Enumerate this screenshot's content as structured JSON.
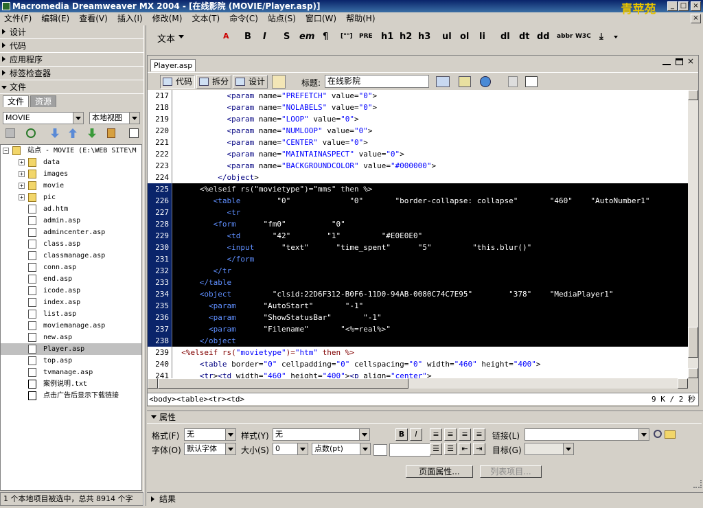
{
  "window": {
    "title": "Macromedia Dreamweaver MX 2004 - [在线影院 (MOVIE/Player.asp)]",
    "watermark": "青苹苑",
    "controls": [
      "_",
      "□",
      "×"
    ]
  },
  "menu": [
    "文件(F)",
    "编辑(E)",
    "查看(V)",
    "插入(I)",
    "修改(M)",
    "文本(T)",
    "命令(C)",
    "站点(S)",
    "窗口(W)",
    "帮助(H)"
  ],
  "left_panels": [
    {
      "label": "设计",
      "open": false
    },
    {
      "label": "代码",
      "open": false
    },
    {
      "label": "应用程序",
      "open": false
    },
    {
      "label": "标签检查器",
      "open": false
    },
    {
      "label": "文件",
      "open": true
    }
  ],
  "files": {
    "tabs": [
      "文件",
      "资源"
    ],
    "site_select": "MOVIE",
    "view_select": "本地视图",
    "root": "站点 - MOVIE (E:\\WEB SITE\\M",
    "items": [
      {
        "name": "data",
        "type": "folder"
      },
      {
        "name": "images",
        "type": "folder"
      },
      {
        "name": "movie",
        "type": "folder"
      },
      {
        "name": "pic",
        "type": "folder"
      },
      {
        "name": "ad.htm",
        "type": "doc"
      },
      {
        "name": "admin.asp",
        "type": "doc"
      },
      {
        "name": "admincenter.asp",
        "type": "doc"
      },
      {
        "name": "class.asp",
        "type": "doc"
      },
      {
        "name": "classmanage.asp",
        "type": "doc"
      },
      {
        "name": "conn.asp",
        "type": "doc"
      },
      {
        "name": "end.asp",
        "type": "doc"
      },
      {
        "name": "icode.asp",
        "type": "doc"
      },
      {
        "name": "index.asp",
        "type": "doc"
      },
      {
        "name": "list.asp",
        "type": "doc"
      },
      {
        "name": "moviemanage.asp",
        "type": "doc"
      },
      {
        "name": "new.asp",
        "type": "doc"
      },
      {
        "name": "Player.asp",
        "type": "doc",
        "selected": true
      },
      {
        "name": "top.asp",
        "type": "doc"
      },
      {
        "name": "tvmanage.asp",
        "type": "doc"
      },
      {
        "name": "案例说明.txt",
        "type": "txt"
      },
      {
        "name": "点击广告后显示下载链接",
        "type": "txt"
      }
    ],
    "status": "1 个本地项目被选中，总共 8914 个字"
  },
  "insert_bar": {
    "category": "文本",
    "items": [
      "B",
      "I",
      "S",
      "em",
      "¶",
      "[\"\"]",
      "PRE",
      "h1",
      "h2",
      "h3",
      "ul",
      "ol",
      "li",
      "dl",
      "dt",
      "dd",
      "abbr",
      "W3C"
    ]
  },
  "document": {
    "tab": "Player.asp",
    "toolbar": {
      "code": "代码",
      "split": "拆分",
      "design": "设计",
      "title_label": "标题:",
      "title_value": "在线影院"
    },
    "lines": [
      {
        "n": "217",
        "text": "            <param name=\"PREFETCH\" value=\"0\">",
        "hl": false
      },
      {
        "n": "218",
        "text": "            <param name=\"NOLABELS\" value=\"0\">",
        "hl": false
      },
      {
        "n": "219",
        "text": "            <param name=\"LOOP\" value=\"0\">",
        "hl": false
      },
      {
        "n": "220",
        "text": "            <param name=\"NUMLOOP\" value=\"0\">",
        "hl": false
      },
      {
        "n": "221",
        "text": "            <param name=\"CENTER\" value=\"0\">",
        "hl": false
      },
      {
        "n": "222",
        "text": "            <param name=\"MAINTAINASPECT\" value=\"0\">",
        "hl": false
      },
      {
        "n": "223",
        "text": "            <param name=\"BACKGROUNDCOLOR\" value=\"#000000\">",
        "hl": false
      },
      {
        "n": "224",
        "text": "          </object>",
        "hl": false
      },
      {
        "n": "225",
        "text": "      <%elseif rs(\"movietype\")=\"mms\" then %>",
        "hl": true
      },
      {
        "n": "226",
        "text": "         <table border=\"0\" cellspacing=\"0\" style=\"border-collapse: collapse\" width=\"460\" id=\"AutoNumber1\"",
        "hl": true
      },
      {
        "n": "227",
        "text": "            <tr>",
        "hl": true
      },
      {
        "n": "228",
        "text": "         <form name=\"fm0\" onsubmit=\"0\">",
        "hl": true
      },
      {
        "n": "229",
        "text": "            <td width=\"42\" height=\"1\" bgcolor=\"#E0E0E0\">",
        "hl": true
      },
      {
        "n": "230",
        "text": "            <input type=\"text\" name=\"time_spent\" size=\"5\" onFocus=\"this.blur()\" style=\"border-style: groove",
        "hl": true
      },
      {
        "n": "231",
        "text": "            </form>",
        "hl": true
      },
      {
        "n": "232",
        "text": "         </tr>",
        "hl": true
      },
      {
        "n": "233",
        "text": "      </table>",
        "hl": true
      },
      {
        "n": "234",
        "text": "      <object classid=\"clsid:22D6F312-B0F6-11D0-94AB-0080C74C7E95\" height=\"378\" id=\"MediaPlayer1\" width=\"46",
        "hl": true
      },
      {
        "n": "235",
        "text": "        <param name=\"AutoStart\" value=\"-1\">",
        "hl": true
      },
      {
        "n": "236",
        "text": "        <param name=\"ShowStatusBar\" value=\"-1\">",
        "hl": true
      },
      {
        "n": "237",
        "text": "        <param name=\"Filename\" value=\"<%=real%>\">",
        "hl": true
      },
      {
        "n": "238",
        "text": "      </object>",
        "hl": true
      },
      {
        "n": "239",
        "text": "  <%elseif rs(\"movietype\")=\"htm\" then %>",
        "hl": false
      },
      {
        "n": "240",
        "text": "      <table border=\"0\" cellpadding=\"0\" cellspacing=\"0\" width=\"460\" height=\"400\">",
        "hl": false
      },
      {
        "n": "241",
        "text": "      <tr><td width=\"460\" height=\"400\"><p align=\"center\">",
        "hl": false
      }
    ],
    "tag_selector": "<body><table><tr><td>",
    "size": "9 K / 2 秒"
  },
  "properties": {
    "header": "属性",
    "format_label": "格式(F)",
    "format_value": "无",
    "style_label": "样式(Y)",
    "style_value": "无",
    "link_label": "链接(L)",
    "font_label": "字体(O)",
    "font_value": "默认字体",
    "size_label": "大小(S)",
    "size_value": "0",
    "unit_value": "点数(pt)",
    "target_label": "目标(G)",
    "page_props_button": "页面属性...",
    "list_item_button": "列表项目..."
  },
  "results": {
    "label": "结果"
  }
}
